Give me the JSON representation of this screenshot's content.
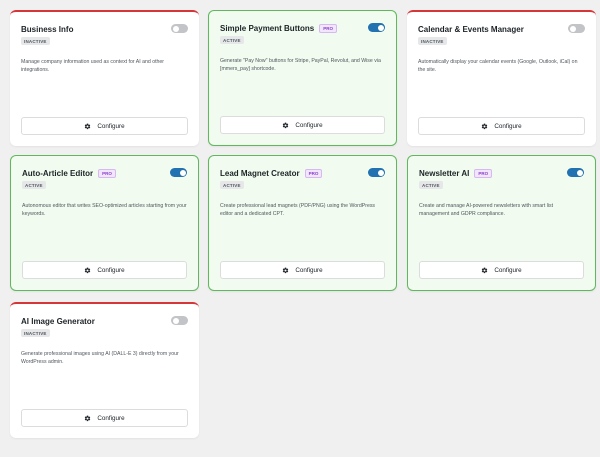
{
  "modules": [
    {
      "title": "Business Info",
      "pro": false,
      "status": "INACTIVE",
      "active": false,
      "description": "Manage company information used as context for AI and other integrations.",
      "button": "Configure",
      "button_icon": "gear-icon"
    },
    {
      "title": "Simple Payment Buttons",
      "pro": true,
      "pro_label": "PRO",
      "status": "ACTIVE",
      "active": true,
      "description": "Generate \"Pay Now\" buttons for Stripe, PayPal, Revolut, and Wise via [mmers_pay] shortcode.",
      "button": "Configure",
      "button_icon": "gear-icon"
    },
    {
      "title": "Calendar & Events Manager",
      "pro": false,
      "status": "INACTIVE",
      "active": false,
      "description": "Automatically display your calendar events (Google, Outlook, iCal) on the site.",
      "button": "Configure",
      "button_icon": "gear-icon"
    },
    {
      "title": "Auto-Article Editor",
      "pro": true,
      "pro_label": "PRO",
      "status": "ACTIVE",
      "active": true,
      "description": "Autonomous editor that writes SEO-optimized articles starting from your keywords.",
      "button": "Configure",
      "button_icon": "gear-icon"
    },
    {
      "title": "Lead Magnet Creator",
      "pro": true,
      "pro_label": "PRO",
      "status": "ACTIVE",
      "active": true,
      "description": "Create professional lead magnets (PDF/PNG) using the WordPress editor and a dedicated CPT.",
      "button": "Configure",
      "button_icon": "gear-icon"
    },
    {
      "title": "Newsletter AI",
      "pro": true,
      "pro_label": "PRO",
      "status": "ACTIVE",
      "active": true,
      "description": "Create and manage AI-powered newsletters with smart list management and GDPR compliance.",
      "button": "Configure",
      "button_icon": "gear-icon"
    },
    {
      "title": "AI Image Generator",
      "pro": false,
      "status": "INACTIVE",
      "active": false,
      "description": "Generate professional images using AI (DALL-E 3) directly from your WordPress admin.",
      "button": "Configure",
      "button_icon": "gear-icon"
    }
  ],
  "colors": {
    "active_border": "#5fb95c",
    "inactive_top": "#d63638",
    "toggle_on": "#2271b1",
    "pro_badge": "#8a3ec9"
  }
}
